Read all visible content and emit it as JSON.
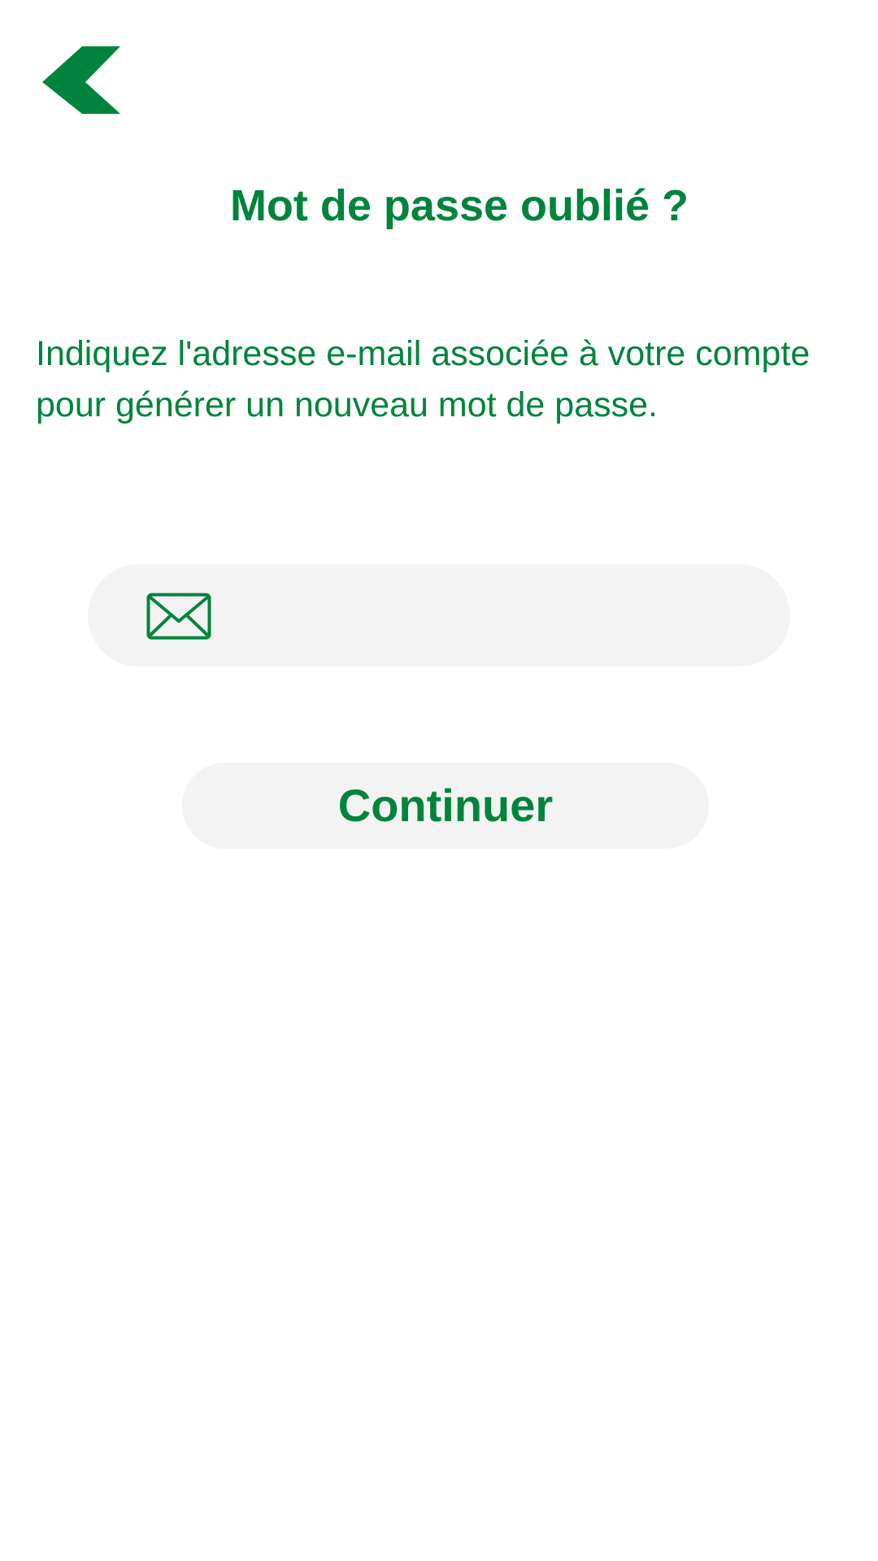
{
  "colors": {
    "brand": "#00843d",
    "field_background": "#f3f3f3",
    "page_background": "#ffffff"
  },
  "header": {
    "back_icon": "chevron-left-icon"
  },
  "page": {
    "title": "Mot de passe oublié ?",
    "description": "Indiquez l'adresse e-mail associée à votre compte pour générer un nouveau mot de passe."
  },
  "form": {
    "email_icon": "envelope-icon",
    "email_value": "",
    "email_placeholder": "",
    "continue_label": "Continuer"
  }
}
